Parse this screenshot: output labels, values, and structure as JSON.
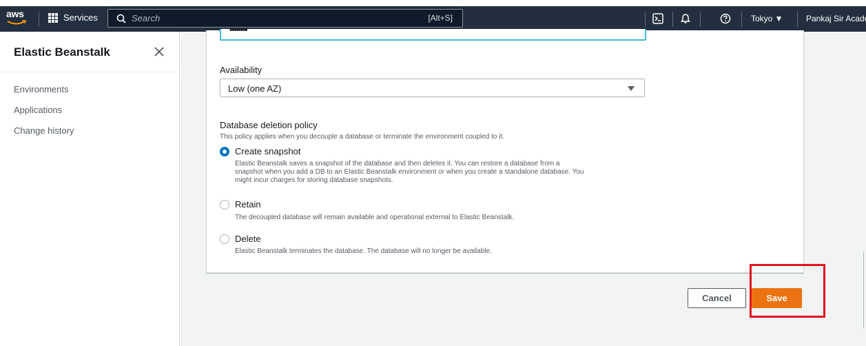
{
  "topnav": {
    "logo_text": "aws",
    "services_label": "Services",
    "search_placeholder": "Search",
    "search_shortcut": "[Alt+S]",
    "region_label": "Tokyo ▼",
    "user_label": "Pankaj Sir Acade",
    "background": "#232f3e"
  },
  "sidepanel": {
    "title": "Elastic Beanstalk",
    "items": [
      {
        "label": "Environments"
      },
      {
        "label": "Applications"
      },
      {
        "label": "Change history"
      }
    ]
  },
  "form": {
    "password_value": "••••••••",
    "availability": {
      "label": "Availability",
      "selected": "Low (one AZ)"
    },
    "deletion_policy": {
      "label": "Database deletion policy",
      "description": "This policy applies when you decouple a database or terminate the environment coupled to it.",
      "options": [
        {
          "label": "Create snapshot",
          "checked": true,
          "description_lines": [
            "Elastic Beanstalk saves a snapshot of the database and then deletes it. You can restore a database from a",
            "snapshot when you add a DB to an Elastic Beanstalk environment or when you create a standalone database. You",
            "might incur charges for storing database snapshots."
          ]
        },
        {
          "label": "Retain",
          "checked": false,
          "description_lines": [
            "The decoupled database will remain available and operational external to Elastic Beanstalk."
          ]
        },
        {
          "label": "Delete",
          "checked": false,
          "description_lines": [
            "Elastic Beanstalk terminates the database. The database will no longer be available."
          ]
        }
      ]
    }
  },
  "actions": {
    "cancel_label": "Cancel",
    "save_label": "Save",
    "save_color": "#ec7211",
    "highlight_color": "#e0141e"
  }
}
